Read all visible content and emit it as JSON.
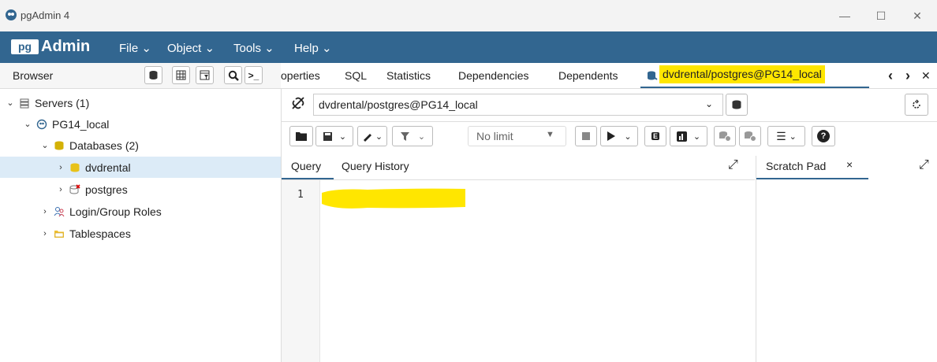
{
  "window": {
    "title": "pgAdmin 4",
    "minimize_glyph": "—",
    "maximize_glyph": "☐",
    "close_glyph": "✕"
  },
  "menubar": {
    "logo_pg": "pg",
    "logo_admin": "Admin",
    "items": [
      {
        "label": "File ⌄"
      },
      {
        "label": "Object ⌄"
      },
      {
        "label": "Tools ⌄"
      },
      {
        "label": "Help ⌄"
      }
    ]
  },
  "browser": {
    "title": "Browser",
    "tree": [
      {
        "label": "Servers (1)",
        "chevron": "⌄"
      },
      {
        "label": "PG14_local",
        "chevron": "⌄"
      },
      {
        "label": "Databases (2)",
        "chevron": "⌄"
      },
      {
        "label": "dvdrental",
        "chevron": "›"
      },
      {
        "label": "postgres",
        "chevron": "›"
      },
      {
        "label": "Login/Group Roles",
        "chevron": "›"
      },
      {
        "label": "Tablespaces",
        "chevron": "›"
      }
    ]
  },
  "tabs": {
    "items": [
      "operties",
      "SQL",
      "Statistics",
      "Dependencies",
      "Dependents"
    ],
    "active": "dvdrental/postgres@PG14_local",
    "nav_prev": "‹",
    "nav_next": "›",
    "nav_close": "✕"
  },
  "query_tool": {
    "connection": "dvdrental/postgres@PG14_local",
    "limit": "No limit",
    "editor_tabs": [
      "Query",
      "Query History"
    ],
    "scratch_pad": "Scratch Pad",
    "scratch_close": "×",
    "line_number": "1"
  },
  "colors": {
    "brand": "#326690",
    "highlight": "#ffe600",
    "active_tab_underline": "#326690"
  }
}
